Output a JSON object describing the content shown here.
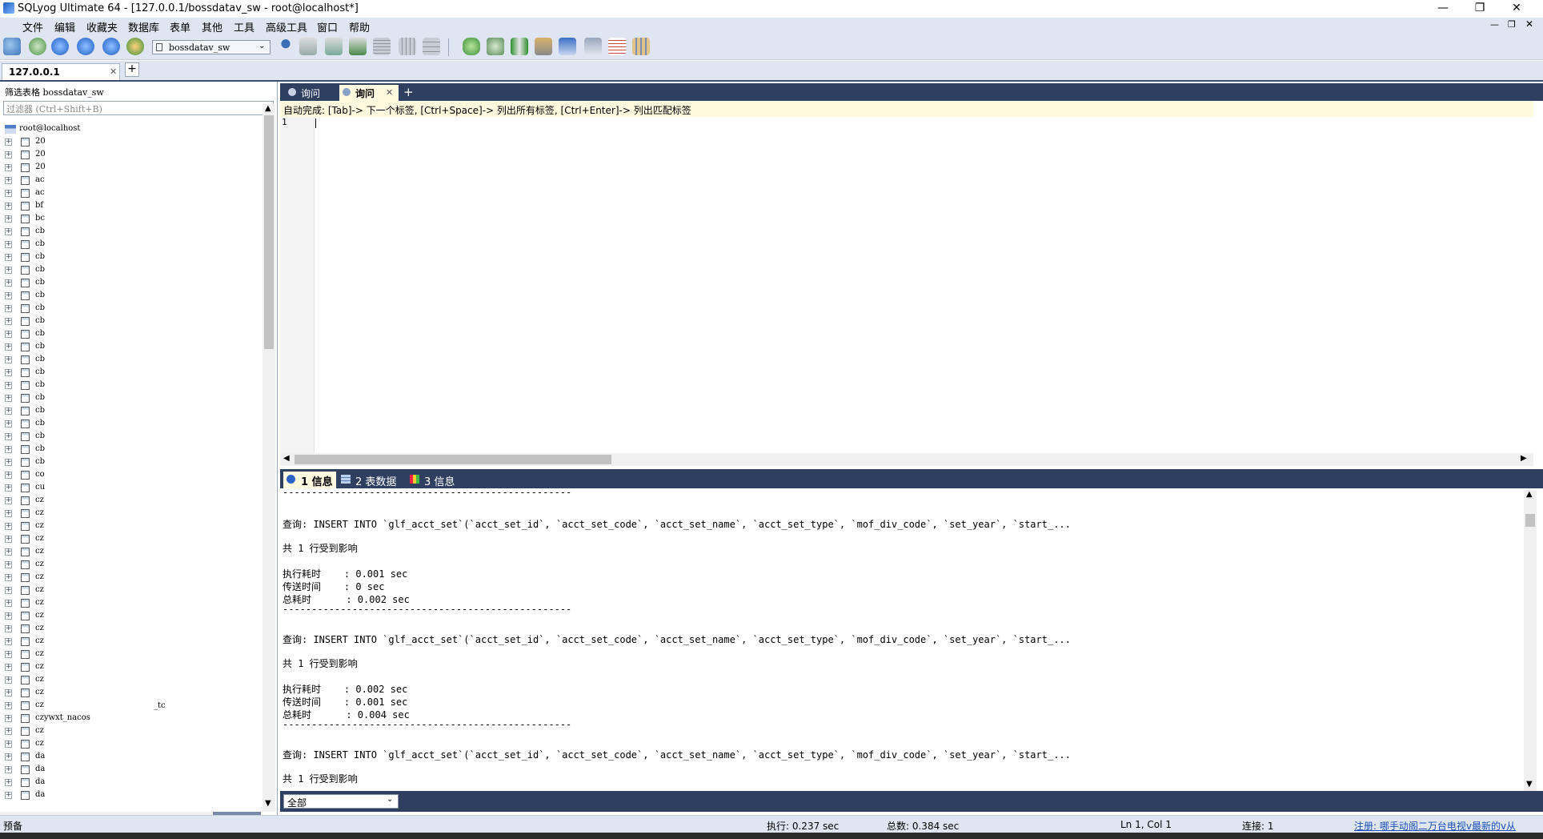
{
  "window": {
    "title": "SQLyog Ultimate 64 - [127.0.0.1/bossdatav_sw - root@localhost*]",
    "minimize": "—",
    "restore": "❐",
    "close": "✕"
  },
  "menu": [
    "文件",
    "编辑",
    "收藏夹",
    "数据库",
    "表单",
    "其他",
    "工具",
    "高级工具",
    "窗口",
    "帮助"
  ],
  "toolbar": {
    "database_selected": "bossdatav_sw"
  },
  "connection_tab": {
    "label": "127.0.0.1",
    "close": "✕",
    "add": "+"
  },
  "object_browser": {
    "filter_label": "筛选表格 bossdatav_sw",
    "filter_placeholder": "过滤器 (Ctrl+Shift+B)",
    "root": "root@localhost",
    "items": [
      "20",
      "20",
      "20",
      "ac",
      "ac",
      "bf",
      "bc",
      "cb",
      "cb",
      "cb",
      "cb",
      "cb",
      "cb",
      "cb",
      "cb",
      "cb",
      "cb",
      "cb",
      "cb",
      "cb",
      "cb",
      "cb",
      "cb",
      "cb",
      "cb",
      "cb",
      "co",
      "cu",
      "cz",
      "cz",
      "cz",
      "cz",
      "cz",
      "cz",
      "cz",
      "cz",
      "cz",
      "cz",
      "cz",
      "cz",
      "cz",
      "cz",
      "cz",
      "cz",
      "cz",
      "czywxt_nacos",
      "cz",
      "cz",
      "da",
      "da",
      "da",
      "da"
    ],
    "trailing_fragment": "_tc"
  },
  "query_tabs": {
    "tab1": "询问",
    "tab2": "询问",
    "close": "✕",
    "add": "+"
  },
  "editor": {
    "autocomplete_hint": "自动完成: [Tab]-> 下一个标签, [Ctrl+Space]-> 列出所有标签, [Ctrl+Enter]-> 列出匹配标签",
    "line_number": "1"
  },
  "result_tabs": {
    "tab1": "1 信息",
    "tab2": "2 表数据",
    "tab3": "3 信息"
  },
  "results": {
    "separator": "--------------------------------------------------",
    "blocks": [
      {
        "query": "查询: INSERT INTO `glf_acct_set`(`acct_set_id`, `acct_set_code`, `acct_set_name`, `acct_set_type`, `mof_div_code`, `set_year`, `start_...",
        "affected": "共 1 行受到影响",
        "exec": "执行耗时    : 0.001 sec",
        "transfer": "传送时间    : 0 sec",
        "total": "总耗时      : 0.002 sec"
      },
      {
        "query": "查询: INSERT INTO `glf_acct_set`(`acct_set_id`, `acct_set_code`, `acct_set_name`, `acct_set_type`, `mof_div_code`, `set_year`, `start_...",
        "affected": "共 1 行受到影响",
        "exec": "执行耗时    : 0.002 sec",
        "transfer": "传送时间    : 0.001 sec",
        "total": "总耗时      : 0.004 sec"
      },
      {
        "query": "查询: INSERT INTO `glf_acct_set`(`acct_set_id`, `acct_set_code`, `acct_set_name`, `acct_set_type`, `mof_div_code`, `set_year`, `start_...",
        "affected": "共 1 行受到影响"
      }
    ],
    "filter_value": "全部"
  },
  "status": {
    "left": "预备",
    "exec": "执行: 0.237 sec",
    "total": "总数: 0.384 sec",
    "position": "Ln 1, Col 1",
    "connections": "连接: 1",
    "register": "注册: 哪手动阁二万台电视v最新的v从"
  },
  "colors": {
    "chrome": "#dfe6f1",
    "dark_tabs": "#2f3f5f",
    "hint_bg": "#fff9e0",
    "register_link": "#1a4fb5"
  }
}
